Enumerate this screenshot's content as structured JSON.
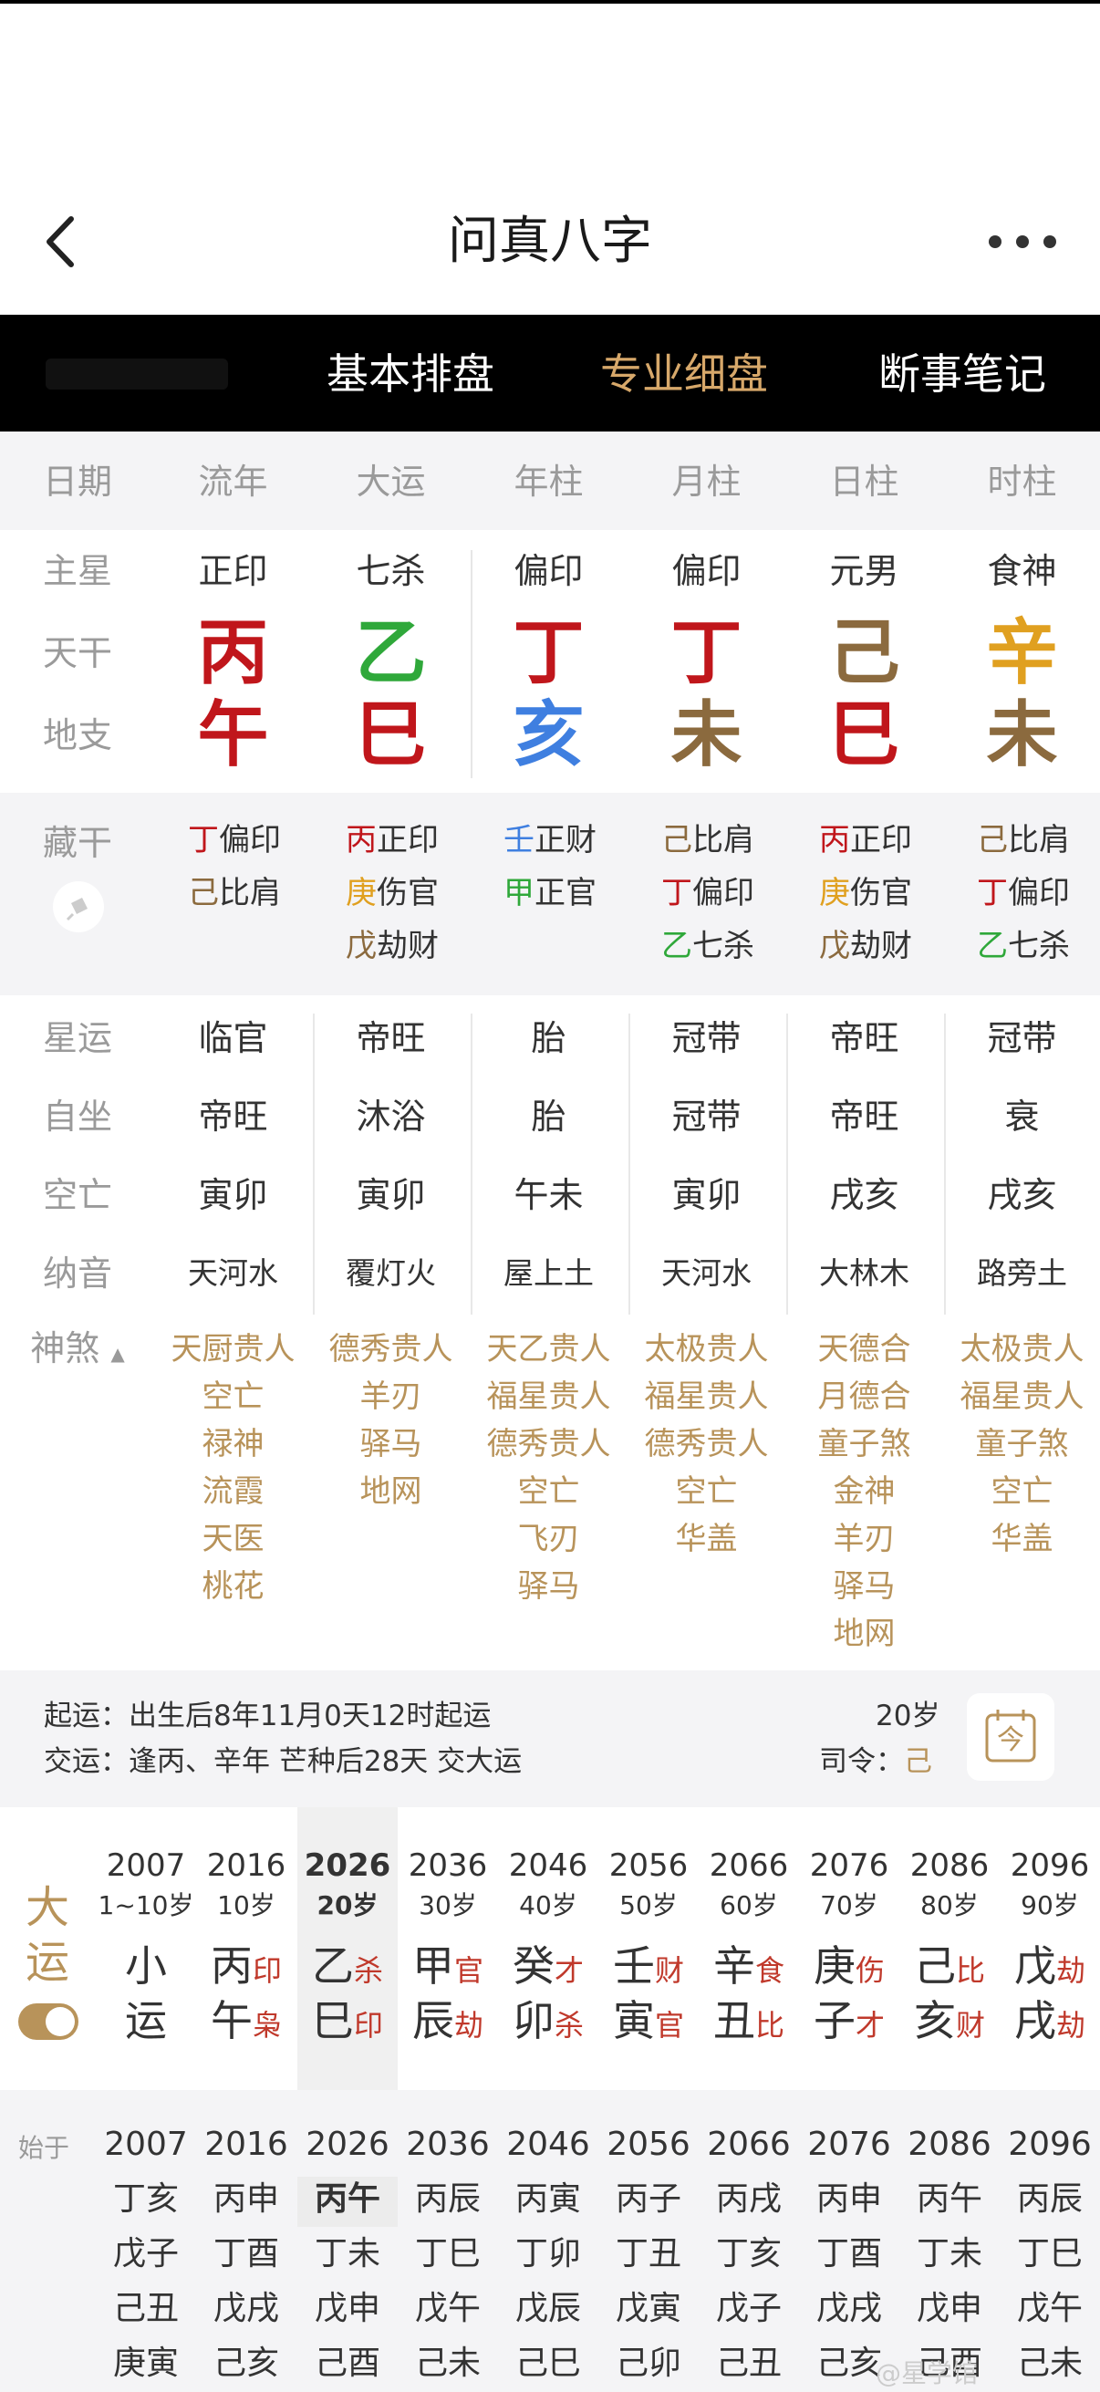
{
  "header": {
    "title": "问真八字"
  },
  "tabs": [
    {
      "label": "基本排盘",
      "active": false
    },
    {
      "label": "专业细盘",
      "active": true
    },
    {
      "label": "断事笔记",
      "active": false
    }
  ],
  "columns": {
    "label": "日期",
    "headers": [
      "流年",
      "大运",
      "年柱",
      "月柱",
      "日柱",
      "时柱"
    ]
  },
  "rows": {
    "main_star": {
      "label": "主星",
      "values": [
        "正印",
        "七杀",
        "偏印",
        "偏印",
        "元男",
        "食神"
      ]
    },
    "tiangan": {
      "label": "天干",
      "values": [
        {
          "c": "丙",
          "color": "#c0161b"
        },
        {
          "c": "乙",
          "color": "#2fa83a"
        },
        {
          "c": "丁",
          "color": "#c0161b"
        },
        {
          "c": "丁",
          "color": "#c0161b"
        },
        {
          "c": "己",
          "color": "#8b6a3e"
        },
        {
          "c": "辛",
          "color": "#e0a020"
        }
      ]
    },
    "dizhi": {
      "label": "地支",
      "values": [
        {
          "c": "午",
          "color": "#c0161b"
        },
        {
          "c": "巳",
          "color": "#c0161b"
        },
        {
          "c": "亥",
          "color": "#3f7fe0"
        },
        {
          "c": "未",
          "color": "#8b6a3e"
        },
        {
          "c": "巳",
          "color": "#c0161b"
        },
        {
          "c": "未",
          "color": "#8b6a3e"
        }
      ]
    }
  },
  "hidden": {
    "label": "藏干",
    "cols": [
      [
        {
          "g": "丁",
          "gc": "#c0161b",
          "t": "偏印"
        },
        {
          "g": "己",
          "gc": "#8b6a3e",
          "t": "比肩"
        }
      ],
      [
        {
          "g": "丙",
          "gc": "#c0161b",
          "t": "正印"
        },
        {
          "g": "庚",
          "gc": "#e0a020",
          "t": "伤官"
        },
        {
          "g": "戊",
          "gc": "#8b6a3e",
          "t": "劫财"
        }
      ],
      [
        {
          "g": "壬",
          "gc": "#3f7fe0",
          "t": "正财"
        },
        {
          "g": "甲",
          "gc": "#2fa83a",
          "t": "正官"
        }
      ],
      [
        {
          "g": "己",
          "gc": "#8b6a3e",
          "t": "比肩"
        },
        {
          "g": "丁",
          "gc": "#c0161b",
          "t": "偏印"
        },
        {
          "g": "乙",
          "gc": "#2fa83a",
          "t": "七杀"
        }
      ],
      [
        {
          "g": "丙",
          "gc": "#c0161b",
          "t": "正印"
        },
        {
          "g": "庚",
          "gc": "#e0a020",
          "t": "伤官"
        },
        {
          "g": "戊",
          "gc": "#8b6a3e",
          "t": "劫财"
        }
      ],
      [
        {
          "g": "己",
          "gc": "#8b6a3e",
          "t": "比肩"
        },
        {
          "g": "丁",
          "gc": "#c0161b",
          "t": "偏印"
        },
        {
          "g": "乙",
          "gc": "#2fa83a",
          "t": "七杀"
        }
      ]
    ]
  },
  "info": {
    "xingyun": {
      "label": "星运",
      "values": [
        "临官",
        "帝旺",
        "胎",
        "冠带",
        "帝旺",
        "冠带"
      ]
    },
    "zizuo": {
      "label": "自坐",
      "values": [
        "帝旺",
        "沐浴",
        "胎",
        "冠带",
        "帝旺",
        "衰"
      ]
    },
    "kongwang": {
      "label": "空亡",
      "values": [
        "寅卯",
        "寅卯",
        "午未",
        "寅卯",
        "戌亥",
        "戌亥"
      ]
    },
    "nayin": {
      "label": "纳音",
      "values": [
        "天河水",
        "覆灯火",
        "屋上土",
        "天河水",
        "大林木",
        "路旁土"
      ]
    },
    "shensha": {
      "label": "神煞",
      "cols": [
        [
          "天厨贵人",
          "空亡",
          "禄神",
          "流霞",
          "天医",
          "桃花"
        ],
        [
          "德秀贵人",
          "羊刃",
          "驿马",
          "地网"
        ],
        [
          "天乙贵人",
          "福星贵人",
          "德秀贵人",
          "空亡",
          "飞刃",
          "驿马"
        ],
        [
          "太极贵人",
          "福星贵人",
          "德秀贵人",
          "空亡",
          "华盖"
        ],
        [
          "天德合",
          "月德合",
          "童子煞",
          "金神",
          "羊刃",
          "驿马",
          "地网"
        ],
        [
          "太极贵人",
          "福星贵人",
          "童子煞",
          "空亡",
          "华盖"
        ]
      ]
    }
  },
  "qiyun": {
    "line1": "起运：出生后8年11月0天12时起运",
    "line2": "交运：逢丙、辛年 芒种后28天 交大运",
    "age": "20岁",
    "siling_label": "司令：",
    "siling_value": "己",
    "cal_char": "今"
  },
  "dayun": {
    "label1": "大",
    "label2": "运",
    "items": [
      {
        "year": "2007",
        "age": "1~10岁",
        "g": "小",
        "gs": "",
        "z": "运",
        "zs": ""
      },
      {
        "year": "2016",
        "age": "10岁",
        "g": "丙",
        "gs": "印",
        "z": "午",
        "zs": "枭"
      },
      {
        "year": "2026",
        "age": "20岁",
        "g": "乙",
        "gs": "杀",
        "z": "巳",
        "zs": "印"
      },
      {
        "year": "2036",
        "age": "30岁",
        "g": "甲",
        "gs": "官",
        "z": "辰",
        "zs": "劫"
      },
      {
        "year": "2046",
        "age": "40岁",
        "g": "癸",
        "gs": "才",
        "z": "卯",
        "zs": "杀"
      },
      {
        "year": "2056",
        "age": "50岁",
        "g": "壬",
        "gs": "财",
        "z": "寅",
        "zs": "官"
      },
      {
        "year": "2066",
        "age": "60岁",
        "g": "辛",
        "gs": "食",
        "z": "丑",
        "zs": "比"
      },
      {
        "year": "2076",
        "age": "70岁",
        "g": "庚",
        "gs": "伤",
        "z": "子",
        "zs": "才"
      },
      {
        "year": "2086",
        "age": "80岁",
        "g": "己",
        "gs": "比",
        "z": "亥",
        "zs": "财"
      },
      {
        "year": "2096",
        "age": "90岁",
        "g": "戊",
        "gs": "劫",
        "z": "戌",
        "zs": "劫"
      }
    ]
  },
  "liunian": {
    "start_label": "始于",
    "cols": [
      [
        "2007",
        "丁亥",
        "戊子",
        "己丑",
        "庚寅"
      ],
      [
        "2016",
        "丙申",
        "丁酉",
        "戊戌",
        "己亥"
      ],
      [
        "2026",
        "丙午",
        "丁未",
        "戊申",
        "己酉"
      ],
      [
        "2036",
        "丙辰",
        "丁巳",
        "戊午",
        "己未"
      ],
      [
        "2046",
        "丙寅",
        "丁卯",
        "戊辰",
        "己巳"
      ],
      [
        "2056",
        "丙子",
        "丁丑",
        "戊寅",
        "己卯"
      ],
      [
        "2066",
        "丙戌",
        "丁亥",
        "戊子",
        "己丑"
      ],
      [
        "2076",
        "丙申",
        "丁酉",
        "戊戌",
        "己亥"
      ],
      [
        "2086",
        "丙午",
        "丁未",
        "戊申",
        "己酉"
      ],
      [
        "2096",
        "丙辰",
        "丁巳",
        "戊午",
        "己未"
      ]
    ]
  },
  "watermark": "@星学馆"
}
